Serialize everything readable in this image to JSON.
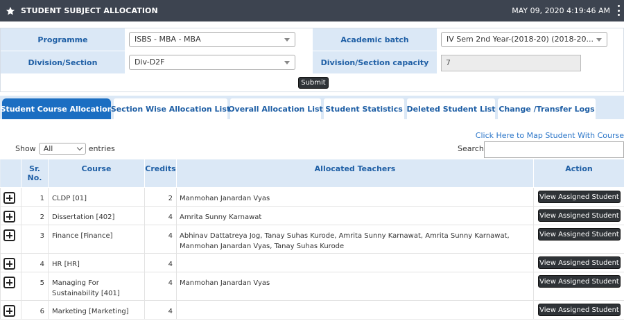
{
  "header": {
    "title": "STUDENT SUBJECT ALLOCATION",
    "datetime": "MAY 09, 2020  4:19:46 AM",
    "icons": {
      "logo": "star-icon",
      "menu": "kebab-menu-icon"
    }
  },
  "form": {
    "programme_label": "Programme",
    "programme_value": "ISBS - MBA - MBA",
    "batch_label": "Academic batch",
    "batch_value": "IV Sem 2nd Year-(2018-20) (2018-20...",
    "division_label": "Division/Section",
    "division_value": "Div-D2F",
    "capacity_label": "Division/Section capacity",
    "capacity_value": "7",
    "submit_label": "Submit"
  },
  "tabs": [
    {
      "label": "Student Course Allocation",
      "active": true
    },
    {
      "label": "Section Wise Allocation List",
      "active": false
    },
    {
      "label": "Overall Allocation List",
      "active": false
    },
    {
      "label": "Student Statistics",
      "active": false
    },
    {
      "label": "Deleted Student List",
      "active": false
    },
    {
      "label": "Change /Transfer Logs",
      "active": false
    }
  ],
  "map_link": "Click Here to Map Student With Course",
  "list_controls": {
    "show_label": "Show",
    "entries_value": "All",
    "entries_label": "entries",
    "search_label": "Search:"
  },
  "table": {
    "headers": {
      "sr": "Sr. No.",
      "course": "Course",
      "credits": "Credits",
      "teachers": "Allocated Teachers",
      "action": "Action"
    },
    "action_label": "View Assigned Student",
    "rows": [
      {
        "sr": "1",
        "course": "CLDP [01]",
        "credits": "2",
        "teachers": "Manmohan Janardan Vyas"
      },
      {
        "sr": "2",
        "course": "Dissertation [402]",
        "credits": "4",
        "teachers": "Amrita Sunny Karnawat"
      },
      {
        "sr": "3",
        "course": "Finance [Finance]",
        "credits": "4",
        "teachers": "Abhinav Dattatreya Jog, Tanay Suhas Kurode, Amrita Sunny Karnawat, Amrita Sunny Karnawat, Manmohan Janardan Vyas, Tanay Suhas Kurode"
      },
      {
        "sr": "4",
        "course": "HR [HR]",
        "credits": "4",
        "teachers": ""
      },
      {
        "sr": "5",
        "course": "Managing For Sustainability [401]",
        "credits": "4",
        "teachers": "Manmohan Janardan Vyas"
      },
      {
        "sr": "6",
        "course": "Marketing [Marketing]",
        "credits": "4",
        "teachers": ""
      }
    ]
  },
  "colors": {
    "topbar": "#3d4450",
    "label_bg": "#dbe8f6",
    "label_text": "#1f5fa5",
    "active_tab": "#1b6ec2",
    "button": "#2f3337",
    "link": "#2a75c8"
  }
}
